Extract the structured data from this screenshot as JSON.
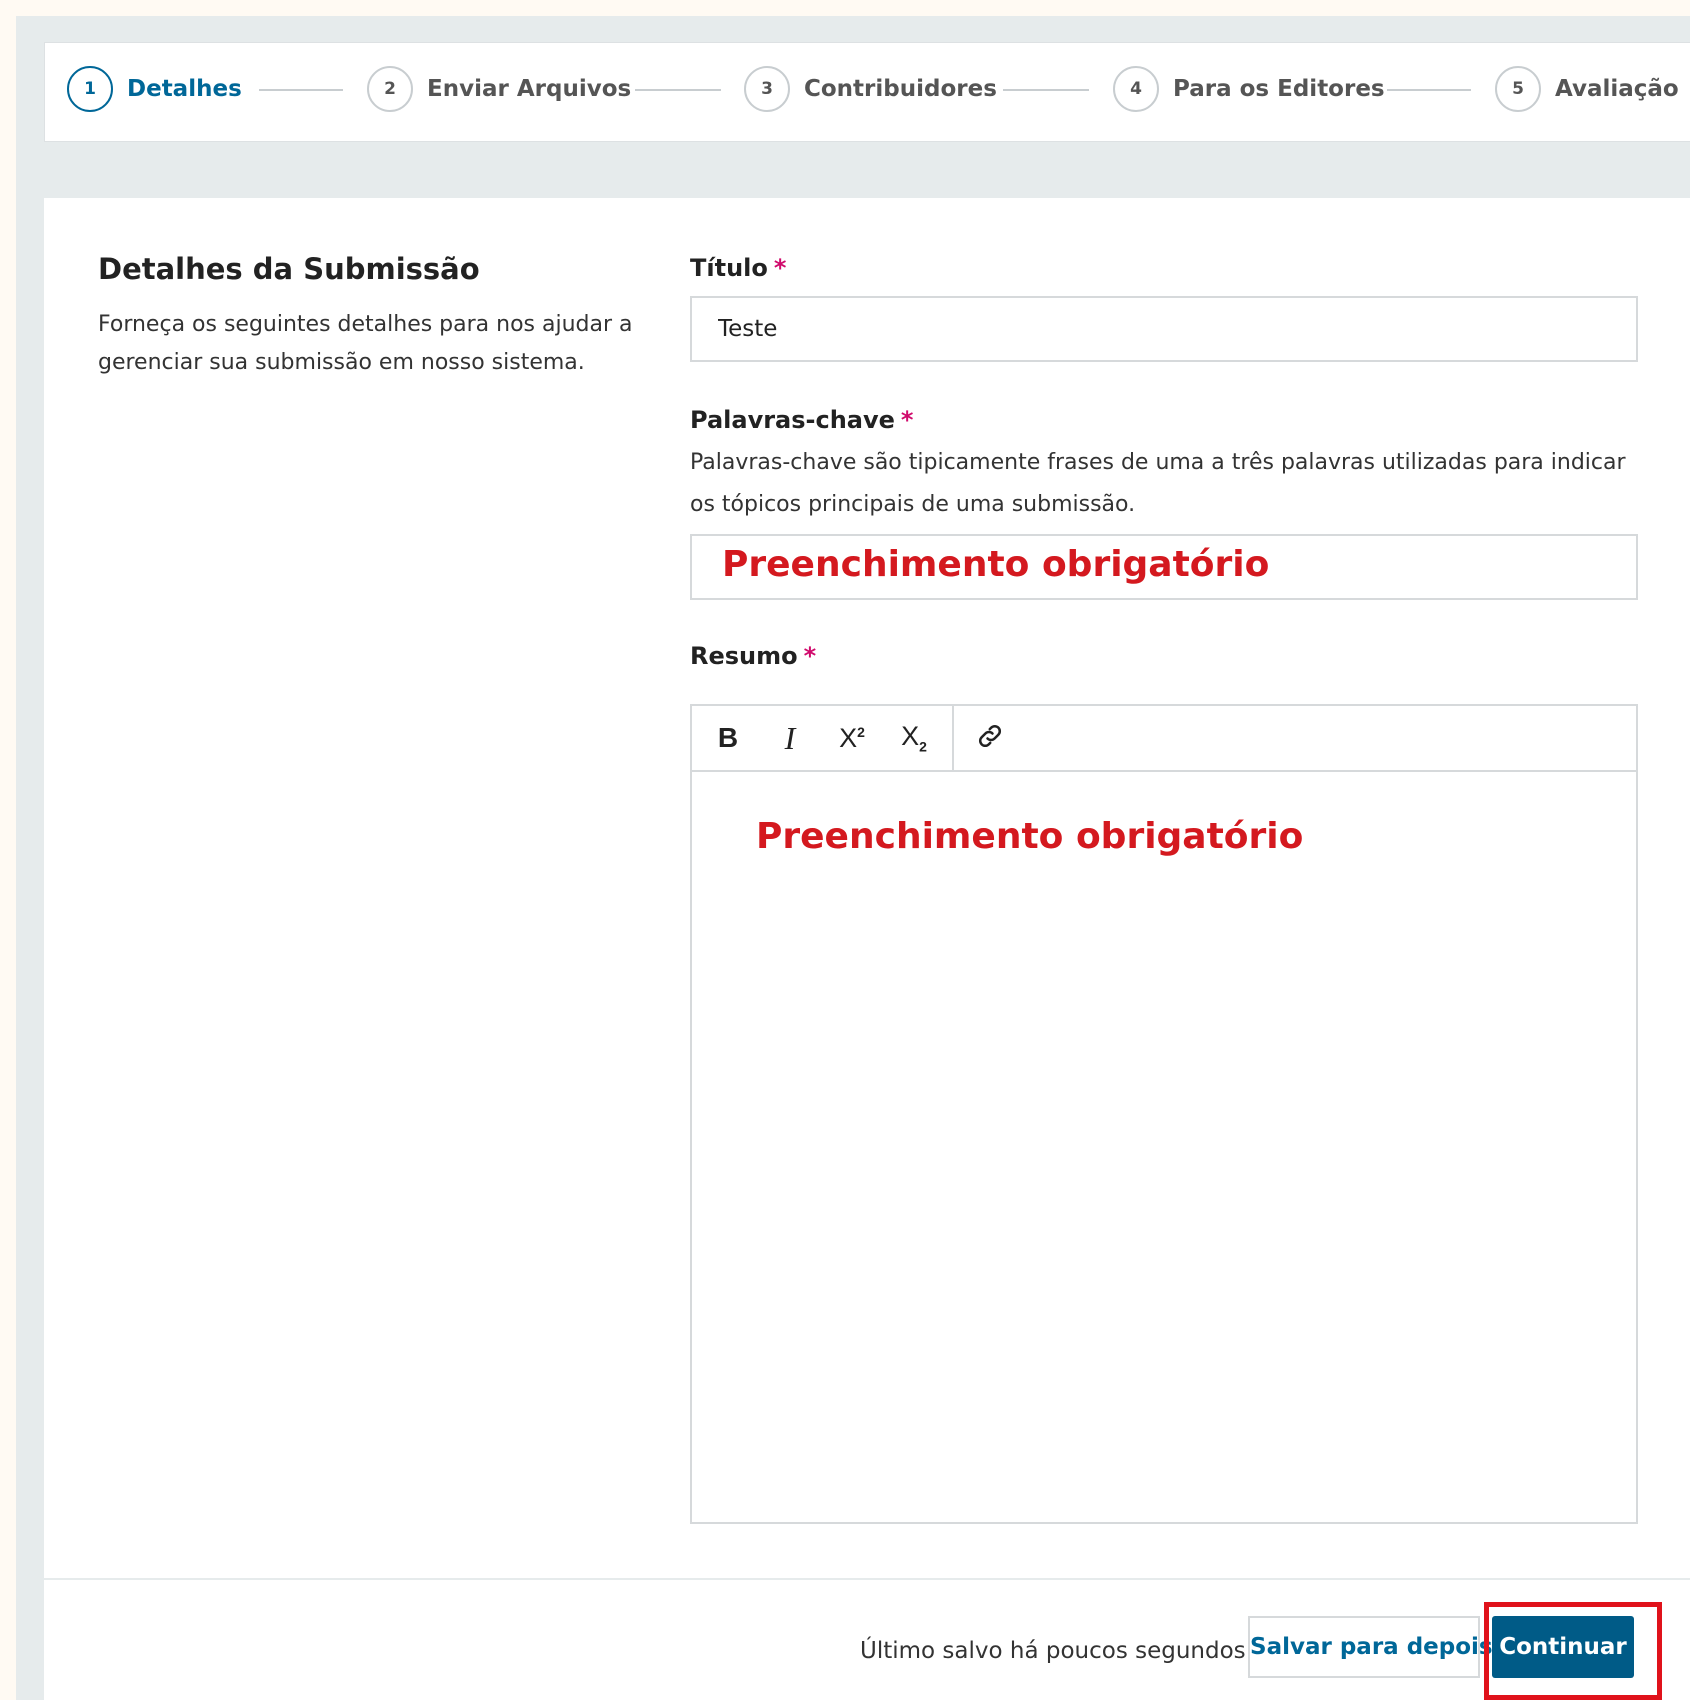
{
  "steps": [
    {
      "number": "1",
      "label": "Detalhes"
    },
    {
      "number": "2",
      "label": "Enviar Arquivos"
    },
    {
      "number": "3",
      "label": "Contribuidores"
    },
    {
      "number": "4",
      "label": "Para os Editores"
    },
    {
      "number": "5",
      "label": "Avaliação"
    }
  ],
  "section": {
    "title": "Detalhes da Submissão",
    "description": "Forneça os seguintes detalhes para nos ajudar a gerenciar sua submissão em nosso sistema."
  },
  "fields": {
    "titulo": {
      "label": "Título",
      "required": "*",
      "value": "Teste"
    },
    "palavras_chave": {
      "label": "Palavras-chave",
      "required": "*",
      "description": "Palavras-chave são tipicamente frases de uma a três palavras utilizadas para indicar os tópicos principais de uma submissão.",
      "annotation": "Preenchimento obrigatório"
    },
    "resumo": {
      "label": "Resumo",
      "required": "*",
      "annotation": "Preenchimento obrigatório"
    }
  },
  "toolbar": {
    "bold": "B",
    "italic": "I",
    "superscript_base": "X",
    "superscript_mark": "2",
    "subscript_base": "X",
    "subscript_mark": "2",
    "link_icon": "link-icon"
  },
  "footer": {
    "status": "Último salvo há poucos segundos",
    "save_later": "Salvar para depois",
    "continue": "Continuar"
  },
  "colors": {
    "accent": "#006798",
    "button": "#005b87",
    "required": "#d00a6c",
    "annotation": "#d4191f"
  }
}
